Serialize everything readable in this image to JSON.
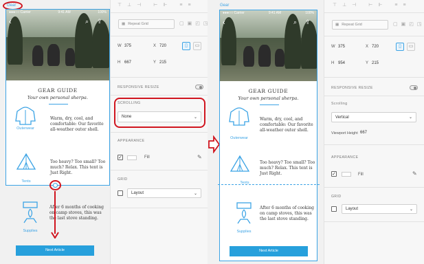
{
  "left": {
    "artboard_label": "Gear",
    "nav": {
      "back_icon": "back-arrow",
      "search_icon": "search",
      "share_icon": "share"
    },
    "status": {
      "carrier": "●●●○○ Carrier",
      "time": "9:41 AM",
      "battery": "100%"
    },
    "title": "GEAR GUIDE",
    "subtitle": "Your own personal sherpa.",
    "items": [
      {
        "caption": "Outerwear",
        "text": "Warm, dry, cool, and comfortable: Our favorite all-weather outer shell."
      },
      {
        "caption": "Tents",
        "text": "Too heavy? Too small? Too much? Relax. This tent is Just Right."
      },
      {
        "caption": "Supplies",
        "text": "After 6 months of cooking on camp stoves, this was the last stove standing."
      }
    ],
    "next_button": "Next Article"
  },
  "panel_left": {
    "repeat_grid": "Repeat Grid",
    "w_label": "W",
    "w": "375",
    "x_label": "X",
    "x": "720",
    "h_label": "H",
    "h": "667",
    "y_label": "Y",
    "y": "215",
    "responsive_resize": "RESPONSIVE RESIZE",
    "scrolling": "SCROLLING",
    "scrolling_value": "None",
    "appearance": "APPEARANCE",
    "fill": "Fill",
    "grid": "GRID",
    "layout": "Layout"
  },
  "right": {
    "artboard_label": "Gear",
    "status": {
      "carrier": "●●●○○ Carrier",
      "time": "9:41 AM",
      "battery": "100%"
    },
    "title": "GEAR GUIDE",
    "subtitle": "Your own personal sherpa.",
    "items": [
      {
        "caption": "Outerwear",
        "text": "Warm, dry, cool, and comfortable: Our favorite all-weather outer shell."
      },
      {
        "caption": "Tents",
        "text": "Too heavy? Too small? Too much? Relax. This tent is Just Right."
      },
      {
        "caption": "Supplies",
        "text": "After 6 months of cooking on camp stoves, this was the last stove standing."
      }
    ],
    "next_button": "Next Article"
  },
  "panel_right": {
    "repeat_grid": "Repeat Grid",
    "w_label": "W",
    "w": "375",
    "x_label": "X",
    "x": "720",
    "h_label": "H",
    "h": "954",
    "y_label": "Y",
    "y": "215",
    "responsive_resize": "RESPONSIVE RESIZE",
    "scrolling": "Scrolling",
    "scrolling_value": "Vertical",
    "viewport_label": "Viewport Height",
    "viewport_value": "667",
    "appearance": "APPEARANCE",
    "fill": "Fill",
    "grid": "GRID",
    "layout": "Layout"
  },
  "colors": {
    "accent": "#3ba3e5",
    "annotation": "#d0141e",
    "button": "#27a0dc"
  }
}
